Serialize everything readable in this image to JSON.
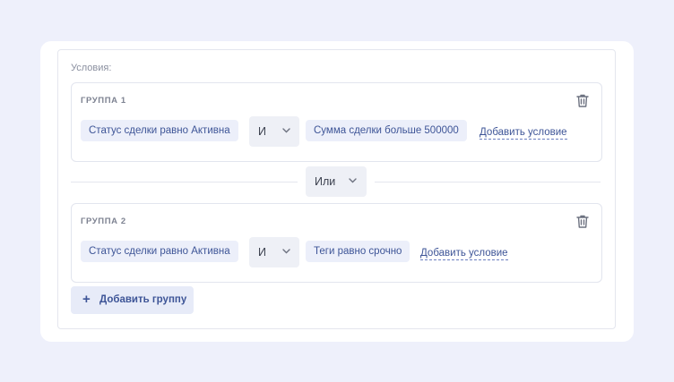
{
  "conditions_label": "Условия:",
  "groups": [
    {
      "title": "ГРУППА 1",
      "conditions": [
        "Статус сделки равно Активна",
        "Сумма сделки больше 500000"
      ],
      "operator": "И",
      "add_condition": "Добавить условие"
    },
    {
      "title": "ГРУППА 2",
      "conditions": [
        "Статус сделки равно Активна",
        "Теги равно срочно"
      ],
      "operator": "И",
      "add_condition": "Добавить условие"
    }
  ],
  "group_operator": "Или",
  "add_group_label": "Добавить группу",
  "icons": {
    "delete": "trash-icon",
    "dropdown": "chevron-down-icon",
    "add": "plus-icon"
  },
  "colors": {
    "accent": "#3e5597",
    "chip_bg": "#eceffa",
    "page_bg": "#eef0fb"
  }
}
